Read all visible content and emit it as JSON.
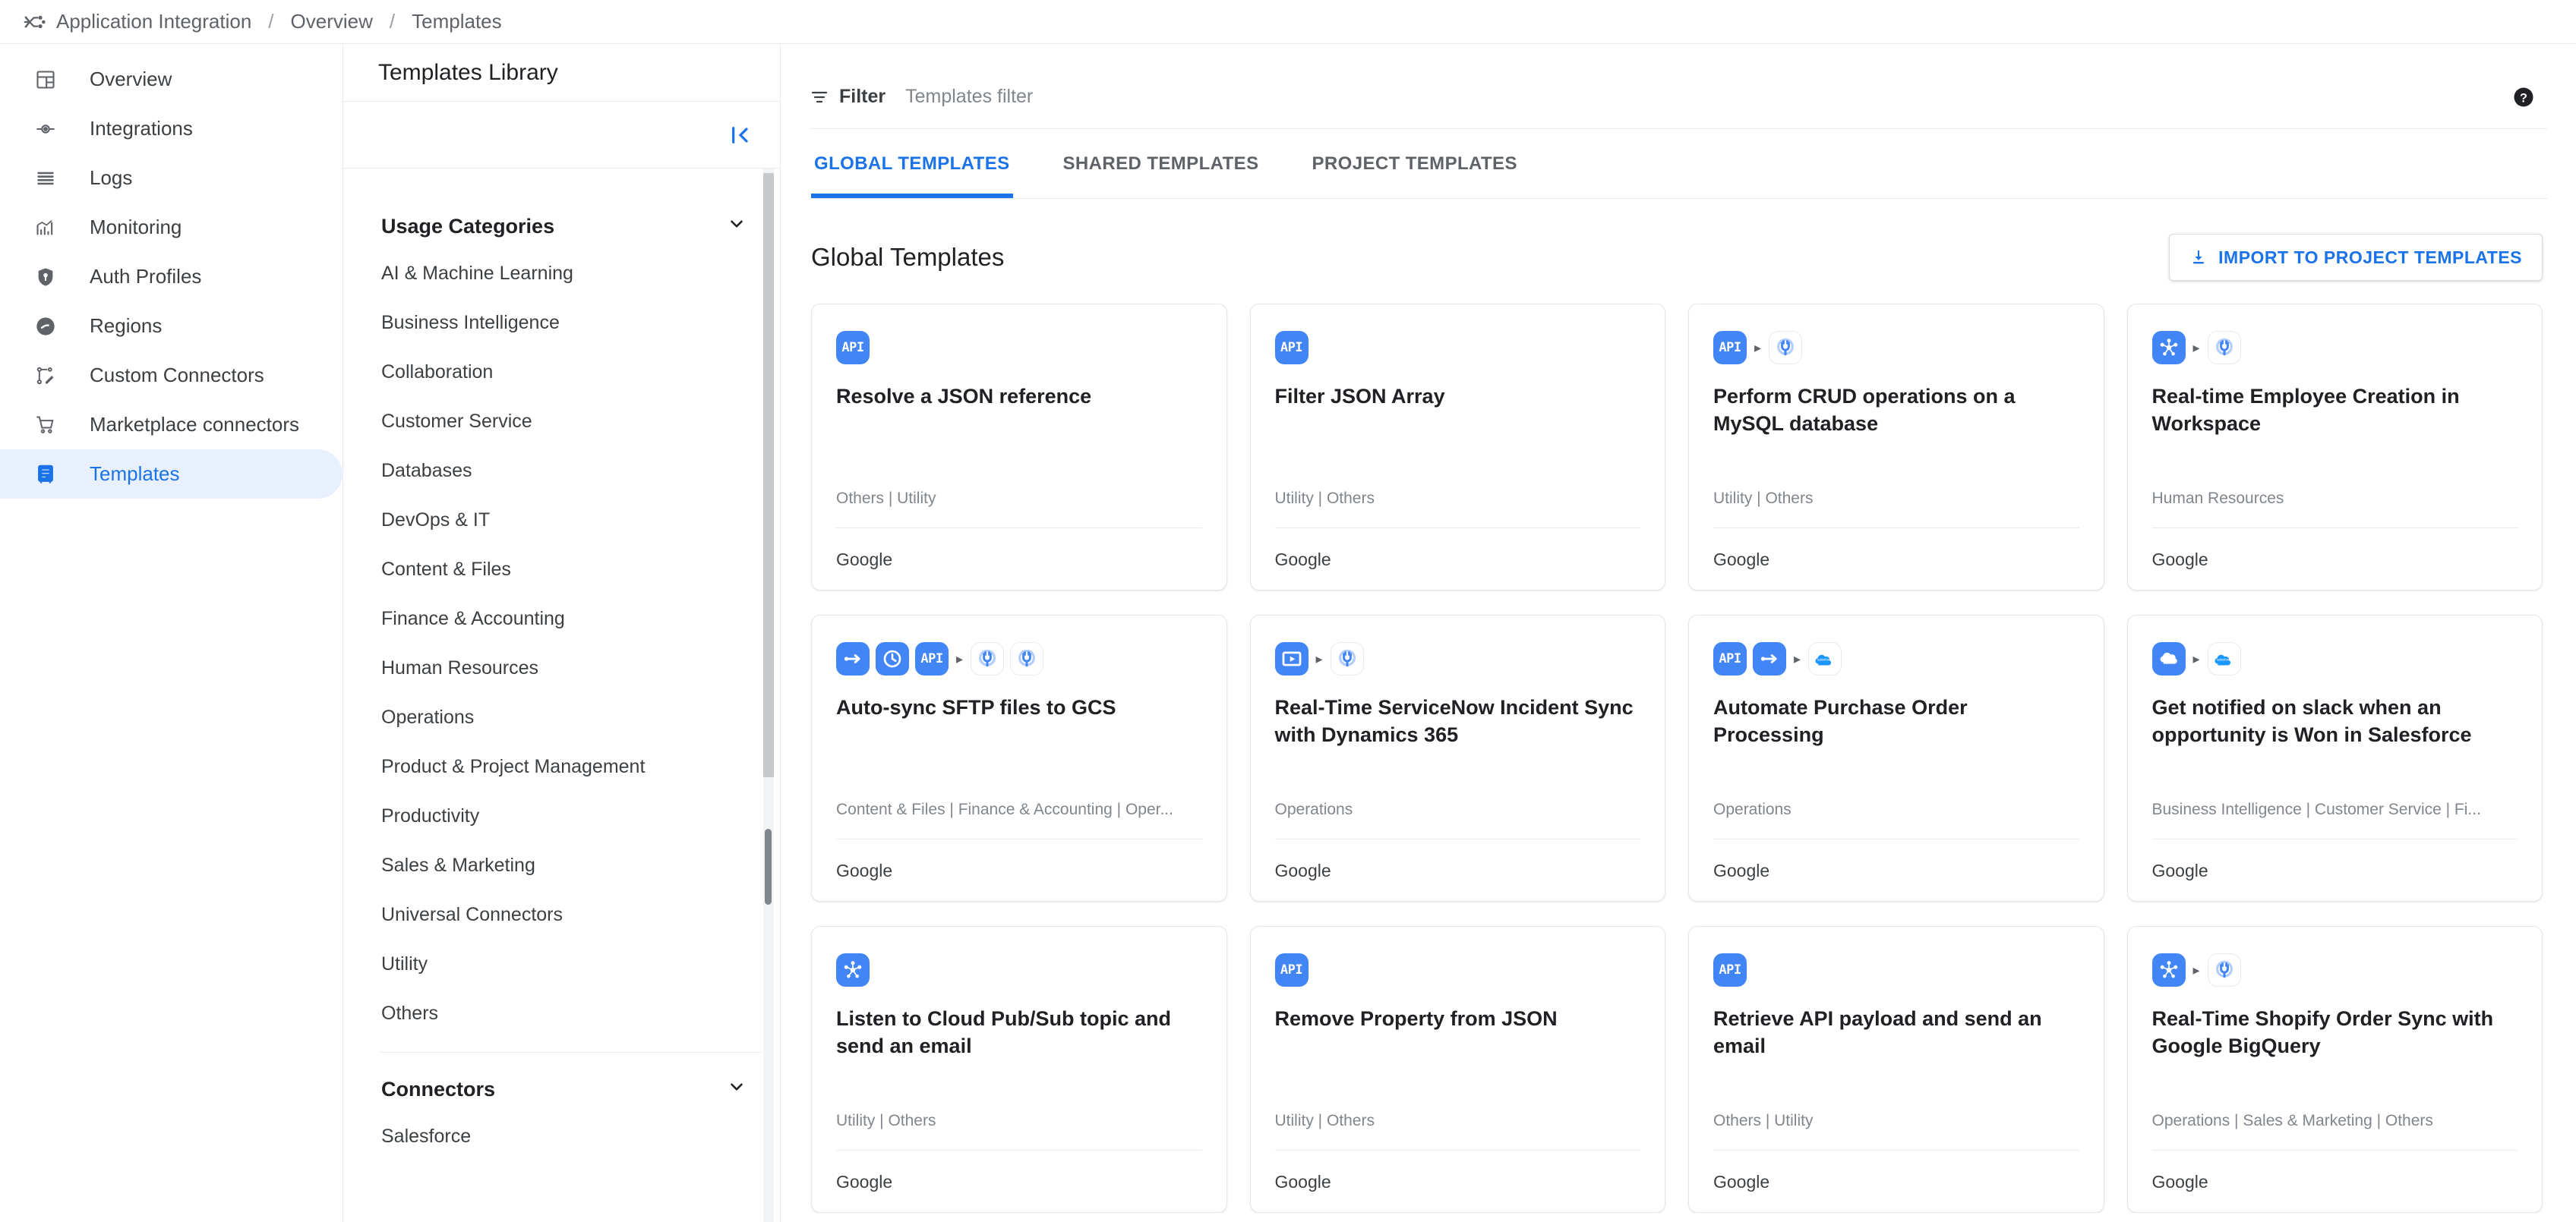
{
  "breadcrumb": {
    "logo_icon": "application-integration-logo",
    "items": [
      "Application Integration",
      "Overview",
      "Templates"
    ],
    "separator": "/"
  },
  "sidebar": {
    "items": [
      {
        "label": "Overview",
        "icon": "dashboard-icon",
        "active": false
      },
      {
        "label": "Integrations",
        "icon": "integrations-icon",
        "active": false
      },
      {
        "label": "Logs",
        "icon": "logs-icon",
        "active": false
      },
      {
        "label": "Monitoring",
        "icon": "monitoring-chart-icon",
        "active": false
      },
      {
        "label": "Auth Profiles",
        "icon": "shield-key-icon",
        "active": false
      },
      {
        "label": "Regions",
        "icon": "globe-icon",
        "active": false
      },
      {
        "label": "Custom Connectors",
        "icon": "custom-connector-edit-icon",
        "active": false
      },
      {
        "label": "Marketplace connectors",
        "icon": "shopping-cart-icon",
        "active": false
      },
      {
        "label": "Templates",
        "icon": "templates-book-icon",
        "active": true
      }
    ]
  },
  "library": {
    "title": "Templates Library",
    "collapse_icon": "collapse-panel-icon",
    "usage_categories": {
      "heading": "Usage Categories",
      "chevron_icon": "chevron-down-icon",
      "items": [
        "AI & Machine Learning",
        "Business Intelligence",
        "Collaboration",
        "Customer Service",
        "Databases",
        "DevOps & IT",
        "Content & Files",
        "Finance & Accounting",
        "Human Resources",
        "Operations",
        "Product & Project Management",
        "Productivity",
        "Sales & Marketing",
        "Universal Connectors",
        "Utility",
        "Others"
      ]
    },
    "connectors": {
      "heading": "Connectors",
      "chevron_icon": "chevron-down-icon",
      "items": [
        "Salesforce"
      ]
    }
  },
  "filter": {
    "icon": "filter-icon",
    "label": "Filter",
    "placeholder": "Templates filter",
    "value": "",
    "help_icon": "help-circle-icon"
  },
  "tabs": [
    {
      "label": "GLOBAL TEMPLATES",
      "active": true
    },
    {
      "label": "SHARED TEMPLATES",
      "active": false
    },
    {
      "label": "PROJECT TEMPLATES",
      "active": false
    }
  ],
  "section": {
    "title": "Global Templates",
    "import_button": {
      "label": "IMPORT TO PROJECT TEMPLATES",
      "icon": "download-icon"
    }
  },
  "colors": {
    "accent": "#1a73e8",
    "chip_blue": "#4285f4",
    "active_nav_bg": "#e8f0fe",
    "muted_text": "#80868b"
  },
  "cards": [
    {
      "icons": [
        {
          "type": "api",
          "style": "blue"
        }
      ],
      "title": "Resolve a JSON reference",
      "categories": "Others | Utility",
      "publisher": "Google"
    },
    {
      "icons": [
        {
          "type": "api",
          "style": "blue"
        }
      ],
      "title": "Filter JSON Array",
      "categories": "Utility | Others",
      "publisher": "Google"
    },
    {
      "icons": [
        {
          "type": "api",
          "style": "blue"
        },
        {
          "type": "arrow-sep"
        },
        {
          "type": "plug",
          "style": "white"
        }
      ],
      "title": "Perform CRUD operations on a MySQL database",
      "categories": "Utility | Others",
      "publisher": "Google"
    },
    {
      "icons": [
        {
          "type": "pubsub",
          "style": "blue"
        },
        {
          "type": "arrow-sep"
        },
        {
          "type": "plug",
          "style": "white"
        }
      ],
      "title": "Real-time Employee Creation in Workspace",
      "categories": "Human Resources",
      "publisher": "Google"
    },
    {
      "icons": [
        {
          "type": "arrowright",
          "style": "blue"
        },
        {
          "type": "clock",
          "style": "blue"
        },
        {
          "type": "api",
          "style": "blue"
        },
        {
          "type": "arrow-sep"
        },
        {
          "type": "plug",
          "style": "white"
        },
        {
          "type": "plug",
          "style": "white"
        }
      ],
      "title": "Auto-sync SFTP files to GCS",
      "categories": "Content & Files | Finance & Accounting | Oper...",
      "publisher": "Google"
    },
    {
      "icons": [
        {
          "type": "play",
          "style": "blue"
        },
        {
          "type": "arrow-sep"
        },
        {
          "type": "plug",
          "style": "white"
        }
      ],
      "title": "Real-Time ServiceNow Incident Sync with Dynamics 365",
      "categories": "Operations",
      "publisher": "Google"
    },
    {
      "icons": [
        {
          "type": "api",
          "style": "blue"
        },
        {
          "type": "arrowright",
          "style": "blue"
        },
        {
          "type": "arrow-sep"
        },
        {
          "type": "salesforce",
          "style": "white"
        }
      ],
      "title": "Automate Purchase Order Processing",
      "categories": "Operations",
      "publisher": "Google"
    },
    {
      "icons": [
        {
          "type": "cloud",
          "style": "blue"
        },
        {
          "type": "arrow-sep"
        },
        {
          "type": "salesforce",
          "style": "white"
        }
      ],
      "title": "Get notified on slack when an opportunity is Won in Salesforce",
      "categories": "Business Intelligence | Customer Service | Fi...",
      "publisher": "Google"
    },
    {
      "icons": [
        {
          "type": "pubsub",
          "style": "blue"
        }
      ],
      "title": "Listen to Cloud Pub/Sub topic and send an email",
      "categories": "Utility | Others",
      "publisher": "Google"
    },
    {
      "icons": [
        {
          "type": "api",
          "style": "blue"
        }
      ],
      "title": "Remove Property from JSON",
      "categories": "Utility | Others",
      "publisher": "Google"
    },
    {
      "icons": [
        {
          "type": "api",
          "style": "blue"
        }
      ],
      "title": "Retrieve API payload and send an email",
      "categories": "Others | Utility",
      "publisher": "Google"
    },
    {
      "icons": [
        {
          "type": "pubsub",
          "style": "blue"
        },
        {
          "type": "arrow-sep"
        },
        {
          "type": "plug",
          "style": "white"
        }
      ],
      "title": "Real-Time Shopify Order Sync with Google BigQuery",
      "categories": "Operations | Sales & Marketing | Others",
      "publisher": "Google"
    }
  ]
}
